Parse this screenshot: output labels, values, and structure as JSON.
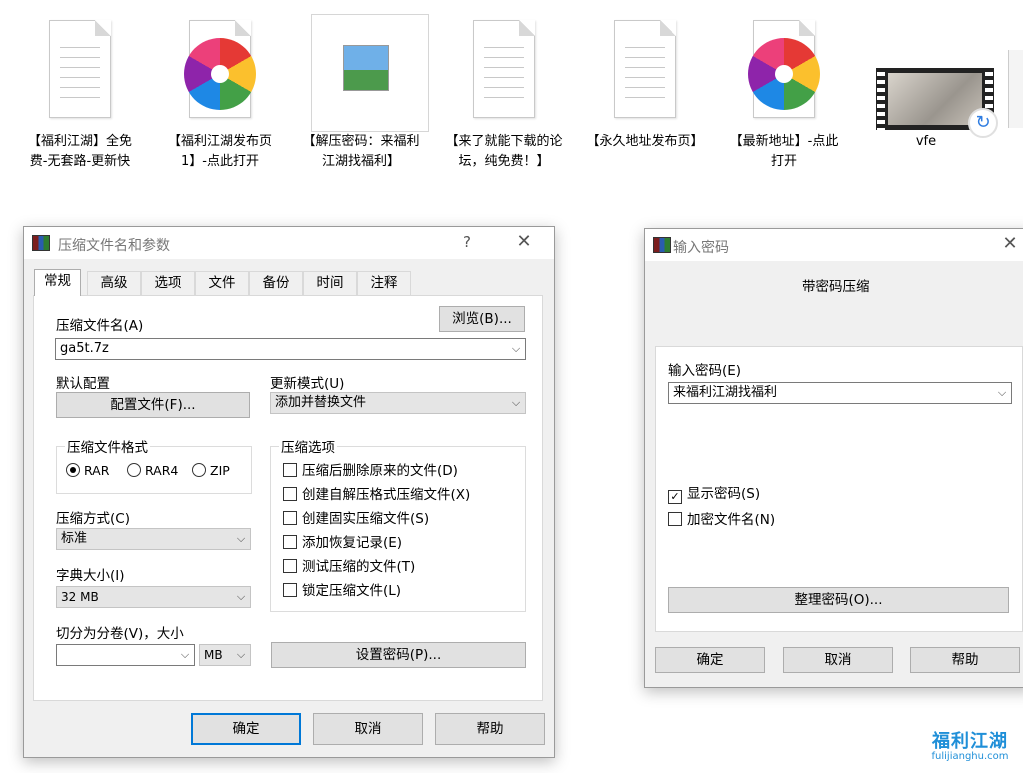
{
  "files": [
    {
      "name": "【福利江湖】全免费-无套路-更新快",
      "icon": "text-document-icon"
    },
    {
      "name": "【福利江湖发布页1】-点此打开",
      "icon": "pinwheel-browser-icon"
    },
    {
      "name": "【解压密码：来福利江湖找福利】",
      "icon": "image-file-icon"
    },
    {
      "name": "【来了就能下载的论坛，纯免费！】",
      "icon": "text-document-icon"
    },
    {
      "name": "【永久地址发布页】",
      "icon": "text-document-icon"
    },
    {
      "name": "【最新地址】-点此打开",
      "icon": "pinwheel-browser-icon"
    },
    {
      "name": "vfe",
      "icon": "video-thumbnail-icon"
    }
  ],
  "archive_dialog": {
    "title": "压缩文件名和参数",
    "help_glyph": "?",
    "close_glyph": "✕",
    "tabs": [
      "常规",
      "高级",
      "选项",
      "文件",
      "备份",
      "时间",
      "注释"
    ],
    "active_tab": "常规",
    "archive_name_label": "压缩文件名(A)",
    "browse_button": "浏览(B)...",
    "archive_name_value": "ga5t.7z",
    "default_profile_label": "默认配置",
    "profiles_button": "配置文件(F)...",
    "update_mode_label": "更新模式(U)",
    "update_mode_value": "添加并替换文件",
    "format_group_title": "压缩文件格式",
    "formats": [
      {
        "label": "RAR",
        "selected": true
      },
      {
        "label": "RAR4",
        "selected": false
      },
      {
        "label": "ZIP",
        "selected": false
      }
    ],
    "method_label": "压缩方式(C)",
    "method_value": "标准",
    "dict_label": "字典大小(I)",
    "dict_value": "32 MB",
    "split_label": "切分为分卷(V)，大小",
    "split_value": "",
    "split_unit": "MB",
    "options_group_title": "压缩选项",
    "options": [
      {
        "label": "压缩后删除原来的文件(D)",
        "checked": false
      },
      {
        "label": "创建自解压格式压缩文件(X)",
        "checked": false
      },
      {
        "label": "创建固实压缩文件(S)",
        "checked": false
      },
      {
        "label": "添加恢复记录(E)",
        "checked": false
      },
      {
        "label": "测试压缩的文件(T)",
        "checked": false
      },
      {
        "label": "锁定压缩文件(L)",
        "checked": false
      }
    ],
    "set_password_button": "设置密码(P)...",
    "ok_button": "确定",
    "cancel_button": "取消",
    "help_button": "帮助"
  },
  "password_dialog": {
    "title": "输入密码",
    "close_glyph": "✕",
    "heading": "带密码压缩",
    "enter_password_label": "输入密码(E)",
    "password_value": "来福利江湖找福利",
    "show_password_label": "显示密码(S)",
    "show_password_checked": true,
    "encrypt_names_label": "加密文件名(N)",
    "encrypt_names_checked": false,
    "organize_button": "整理密码(O)...",
    "ok_button": "确定",
    "cancel_button": "取消",
    "help_button": "帮助"
  },
  "watermark": {
    "logo_text": "福利江湖",
    "domain": "fulijianghu.com",
    "color": "#1f8fd8"
  },
  "colors": {
    "dialog_bg": "#f0f0f0",
    "default_button_border": "#0078d7"
  }
}
